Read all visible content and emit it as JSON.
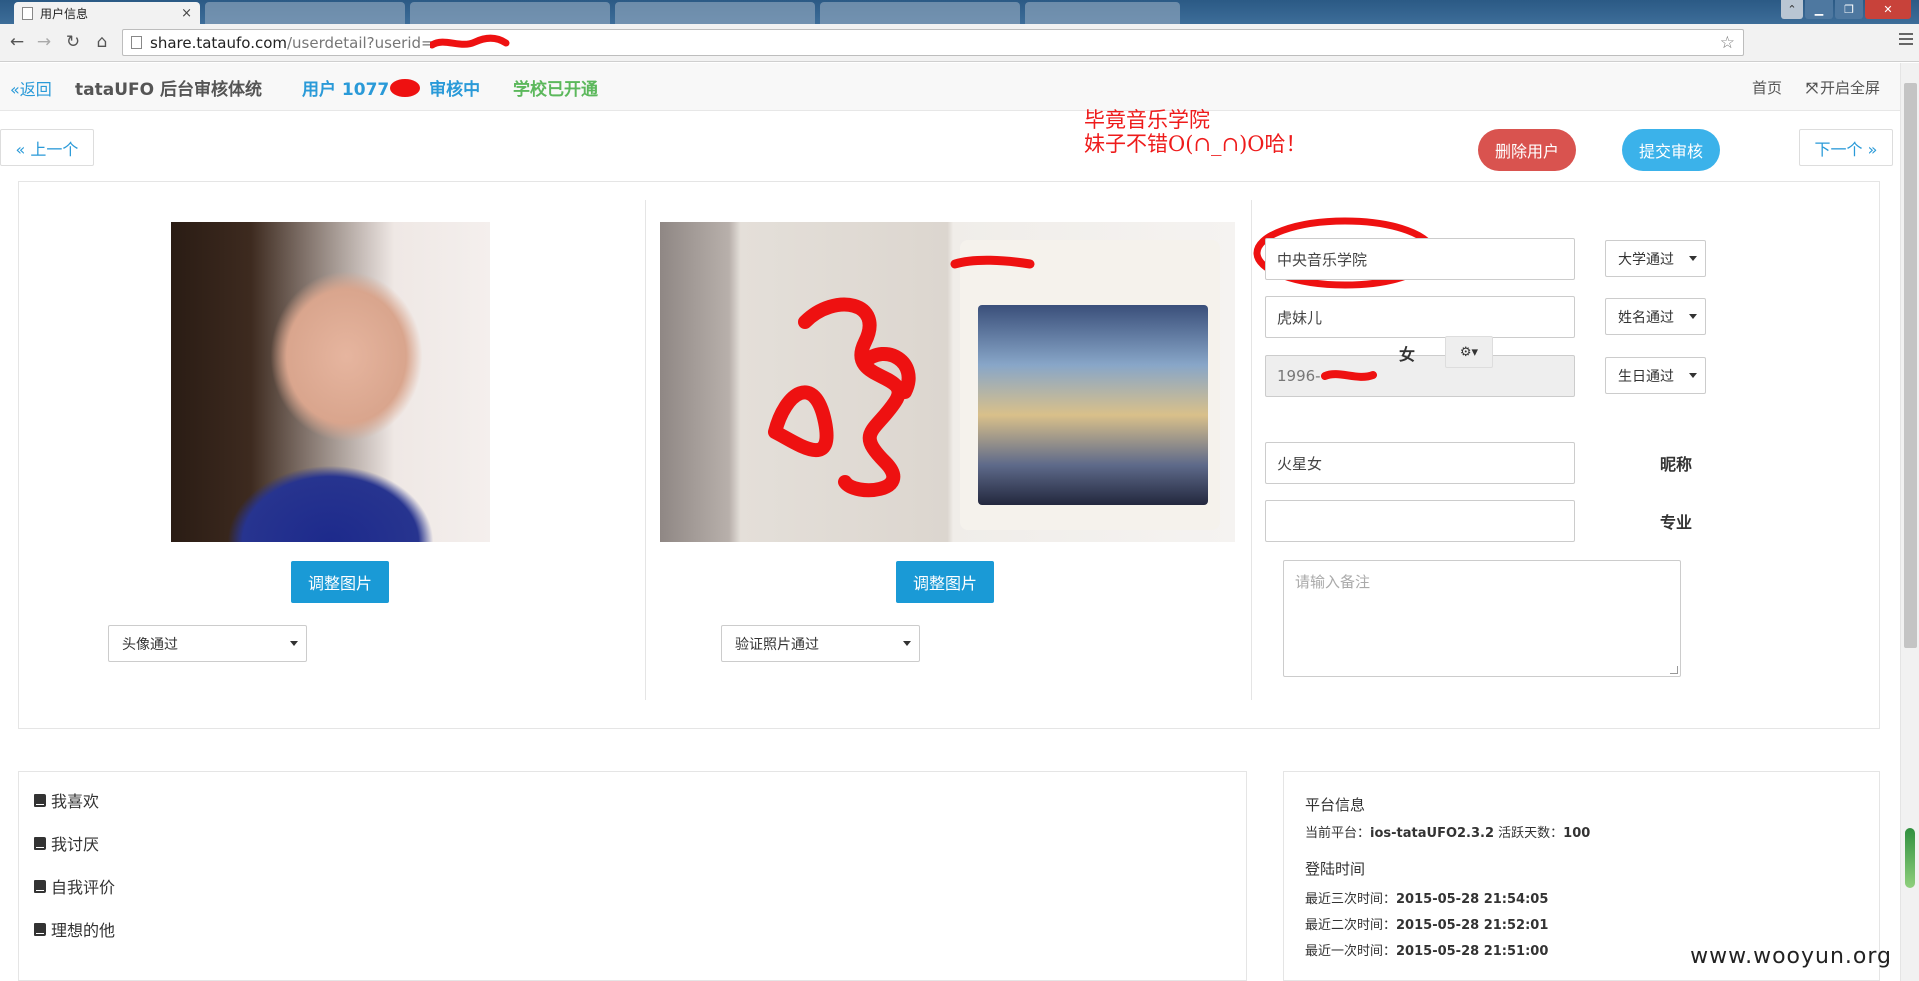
{
  "browser": {
    "tab_title": "用户信息",
    "close_tab": "×",
    "url_host": "share.tataufo.com",
    "url_path": "/userdetail?userid="
  },
  "topnav": {
    "back": "«返回",
    "brand": "tataUFO 后台审核体统",
    "user_prefix": "用户 1077",
    "user_state": "审核中",
    "school_status": "学校已开通",
    "home": "首页",
    "fullscreen": "开启全屏"
  },
  "annotation": {
    "line1": "毕竟音乐学院",
    "line2": "妹子不错O(∩_∩)O哈！"
  },
  "actions": {
    "prev": "« 上一个",
    "next": "下一个 »",
    "delete": "删除用户",
    "submit": "提交审核"
  },
  "photos": {
    "adjust_label": "调整图片",
    "avatar_select": "头像通过",
    "verify_select": "验证照片通过"
  },
  "profile": {
    "school": "中央音乐学院",
    "school_status": "大学通过",
    "name": "虎妹儿",
    "name_status": "姓名通过",
    "birthday": "1996-",
    "birthday_status": "生日通过",
    "gender": "女",
    "nickname": "火星女",
    "nickname_label": "昵称",
    "major": "",
    "major_label": "专业",
    "remark_placeholder": "请输入备注"
  },
  "preferences": {
    "items": [
      "我喜欢",
      "我讨厌",
      "自我评价",
      "理想的他"
    ]
  },
  "platform": {
    "title": "平台信息",
    "platform_label": "当前平台：",
    "platform_value": "ios-tataUFO2.3.2",
    "active_label": "活跃天数：",
    "active_value": "100",
    "login_title": "登陆时间",
    "logins": [
      {
        "label": "最近三次时间：",
        "value": "2015-05-28 21:54:05"
      },
      {
        "label": "最近二次时间：",
        "value": "2015-05-28 21:52:01"
      },
      {
        "label": "最近一次时间：",
        "value": "2015-05-28 21:51:00"
      }
    ]
  },
  "watermark": "www.wooyun.org",
  "colors": {
    "accent_blue": "#2a9ad8",
    "danger": "#d9534f",
    "submit": "#3bb2ea",
    "success": "#5cb85c",
    "annotation": "#ee1b1b"
  }
}
